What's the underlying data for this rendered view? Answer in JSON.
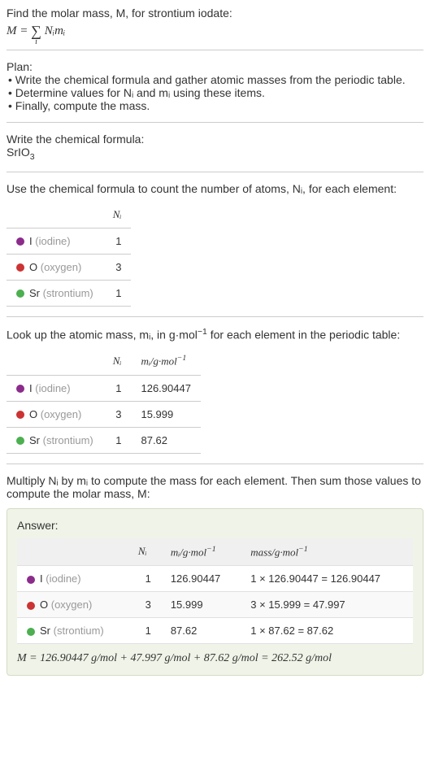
{
  "intro": {
    "line1": "Find the molar mass, M, for strontium iodate:",
    "formula_lhs": "M = ",
    "formula_sum": "∑",
    "formula_sub": "i",
    "formula_rhs": " Nᵢmᵢ"
  },
  "plan": {
    "title": "Plan:",
    "items": [
      "• Write the chemical formula and gather atomic masses from the periodic table.",
      "• Determine values for Nᵢ and mᵢ using these items.",
      "• Finally, compute the mass."
    ]
  },
  "formula_section": {
    "title": "Write the chemical formula:",
    "formula": "SrIO",
    "formula_sub": "3"
  },
  "count_section": {
    "title": "Use the chemical formula to count the number of atoms, Nᵢ, for each element:",
    "header_n": "Nᵢ",
    "rows": [
      {
        "symbol": "I",
        "name": "(iodine)",
        "n": "1"
      },
      {
        "symbol": "O",
        "name": "(oxygen)",
        "n": "3"
      },
      {
        "symbol": "Sr",
        "name": "(strontium)",
        "n": "1"
      }
    ]
  },
  "mass_section": {
    "title_pre": "Look up the atomic mass, mᵢ, in g·mol",
    "title_sup": "−1",
    "title_post": " for each element in the periodic table:",
    "header_n": "Nᵢ",
    "header_m_pre": "mᵢ/g·mol",
    "header_m_sup": "−1",
    "rows": [
      {
        "symbol": "I",
        "name": "(iodine)",
        "n": "1",
        "m": "126.90447"
      },
      {
        "symbol": "O",
        "name": "(oxygen)",
        "n": "3",
        "m": "15.999"
      },
      {
        "symbol": "Sr",
        "name": "(strontium)",
        "n": "1",
        "m": "87.62"
      }
    ]
  },
  "multiply_section": {
    "text": "Multiply Nᵢ by mᵢ to compute the mass for each element. Then sum those values to compute the molar mass, M:"
  },
  "answer": {
    "label": "Answer:",
    "header_n": "Nᵢ",
    "header_m_pre": "mᵢ/g·mol",
    "header_m_sup": "−1",
    "header_mass_pre": "mass/g·mol",
    "header_mass_sup": "−1",
    "rows": [
      {
        "symbol": "I",
        "name": "(iodine)",
        "n": "1",
        "m": "126.90447",
        "mass": "1 × 126.90447 = 126.90447"
      },
      {
        "symbol": "O",
        "name": "(oxygen)",
        "n": "3",
        "m": "15.999",
        "mass": "3 × 15.999 = 47.997"
      },
      {
        "symbol": "Sr",
        "name": "(strontium)",
        "n": "1",
        "m": "87.62",
        "mass": "1 × 87.62 = 87.62"
      }
    ],
    "final": "M = 126.90447 g/mol + 47.997 g/mol + 87.62 g/mol = 262.52 g/mol"
  }
}
